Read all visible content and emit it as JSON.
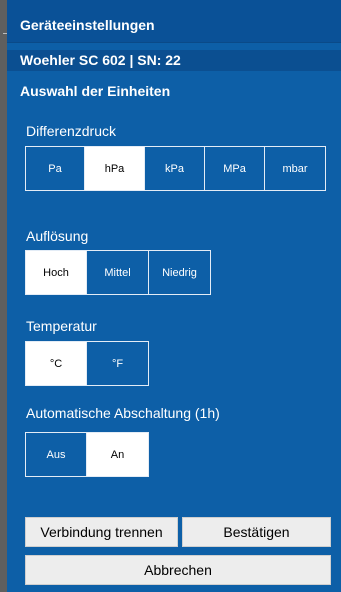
{
  "dialog": {
    "title": "Geräteeinstellungen",
    "device": "Woehler SC 602 | SN:  22",
    "section_title": "Auswahl der Einheiten"
  },
  "differenzdruck": {
    "label": "Differenzdruck",
    "options": [
      "Pa",
      "hPa",
      "kPa",
      "MPa",
      "mbar"
    ],
    "selected": "hPa"
  },
  "aufloesung": {
    "label": "Auflösung",
    "options": [
      "Hoch",
      "Mittel",
      "Niedrig"
    ],
    "selected": "Hoch"
  },
  "temperatur": {
    "label": "Temperatur",
    "options": [
      "°C",
      "°F"
    ],
    "selected": "°C"
  },
  "abschaltung": {
    "label": "Automatische Abschaltung (1h)",
    "options": [
      "Aus",
      "An"
    ],
    "selected": "An"
  },
  "buttons": {
    "disconnect": "Verbindung trennen",
    "confirm": "Bestätigen",
    "cancel": "Abbrechen"
  },
  "colors": {
    "dialog_bg": "#0d5fa7",
    "header_bg": "#0a5197",
    "selected_bg": "#ffffff",
    "button_bg": "#ededed"
  }
}
